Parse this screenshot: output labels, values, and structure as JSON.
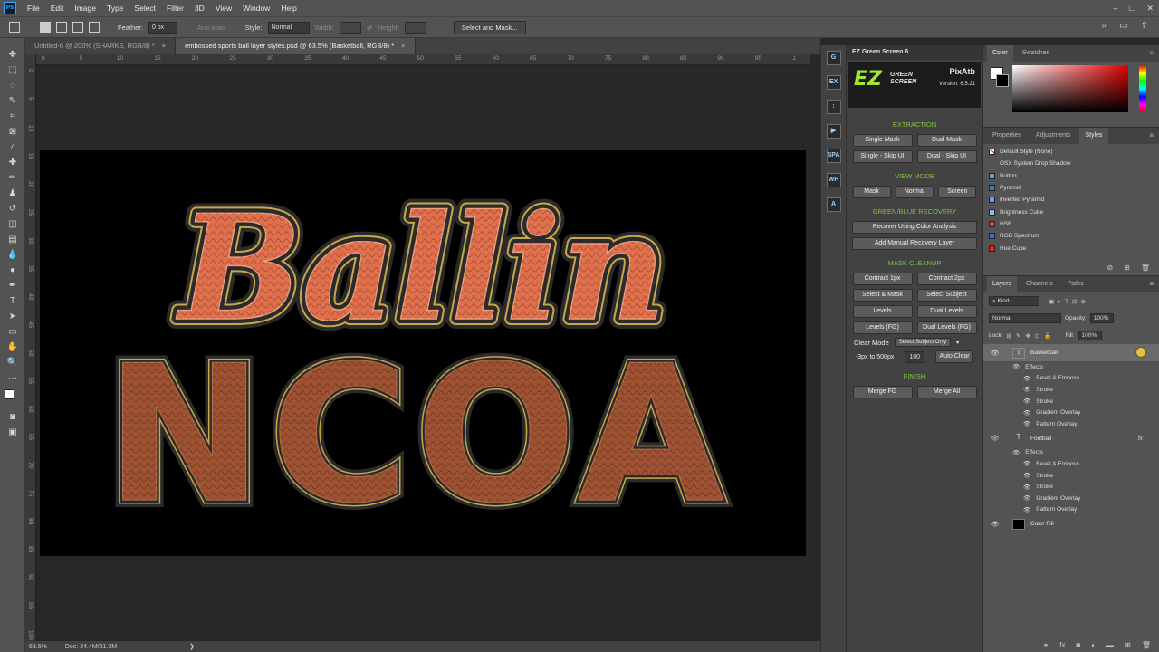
{
  "app": {
    "logo": "Ps"
  },
  "menu": [
    "File",
    "Edit",
    "Image",
    "Type",
    "Select",
    "Filter",
    "3D",
    "View",
    "Window",
    "Help"
  ],
  "window_controls": [
    "–",
    "❐",
    "✕"
  ],
  "options_bar": {
    "feather_label": "Feather:",
    "feather_value": "0 px",
    "anti_alias_label": "Anti-alias",
    "style_label": "Style:",
    "style_value": "Normal",
    "width_label": "Width:",
    "height_label": "Height:",
    "select_mask_button": "Select and Mask..."
  },
  "tabs": [
    {
      "label": "Untitled-6 @ 200% (SHARKS, RGB/8) *",
      "close": "×"
    },
    {
      "label": "embossed sports ball layer styles.psd @ 63.5% (Basketball, RGB/8) *",
      "close": "×"
    }
  ],
  "ruler": {
    "h_ticks": [
      "0",
      "5",
      "10",
      "15",
      "20",
      "25",
      "30",
      "35",
      "40",
      "45",
      "50",
      "55",
      "60",
      "65",
      "70",
      "75",
      "80",
      "85",
      "90",
      "95",
      "1"
    ],
    "v_ticks": [
      "0",
      "5",
      "10",
      "15",
      "20",
      "25",
      "30",
      "35",
      "40",
      "45",
      "50",
      "55",
      "60",
      "65",
      "70",
      "75",
      "80",
      "85",
      "90",
      "95",
      "100"
    ]
  },
  "canvas": {
    "line1": "Ballin",
    "line2": "NCOA",
    "colors": {
      "ballin_fill": "#e2704c",
      "ncoa_fill": "#9e5232",
      "stroke_gold": "#c8a64a",
      "stroke_dark": "#2a2a2a"
    }
  },
  "status": {
    "zoom": "63.5%",
    "doc": "Doc: 24.4M/31.3M",
    "arrow": "❯"
  },
  "ez_strip": [
    "G",
    "EX",
    "↕",
    "▶",
    "SPA",
    "WH",
    "A"
  ],
  "ez_panel": {
    "title": "EZ Green Screen 6",
    "logo": "EZ",
    "logo_sub1": "GREEN",
    "logo_sub2": "SCREEN",
    "brand": "PixAtb",
    "version": "Version: 6.5.21",
    "sections": {
      "extraction": "EXTRACTION",
      "view_mode": "VIEW MODE",
      "recovery": "GREEN/BLUE RECOVERY",
      "cleanup": "MASK CLEANUP",
      "finish": "FINISH"
    },
    "buttons": {
      "single_mask": "Single Mask",
      "dual_mask": "Dual Mask",
      "single_skip": "Single - Skip UI",
      "dual_skip": "Dual - Skip UI",
      "mask": "Mask",
      "normal": "Normal",
      "screen": "Screen",
      "recover_color": "Recover Using Color Analysis",
      "add_manual": "Add Manual Recovery Layer",
      "contract1": "Contract 1px",
      "contract2": "Contract 2px",
      "select_mask": "Select & Mask",
      "select_subject": "Select Subject",
      "levels": "Levels",
      "dual_levels": "Dual Levels",
      "levels_fg": "Levels (FG)",
      "dual_levels_fg": "Dual Levels (FG)",
      "auto_clear": "Auto Clear",
      "merge_fg": "Merge FG",
      "merge_all": "Merge All"
    },
    "clear_mode_label": "Clear Mode",
    "clear_mode_value": "Select Subject Only",
    "range_label": "-3px to 500px",
    "range_value": "100"
  },
  "color_panel": {
    "tabs": [
      "Color",
      "Swatches"
    ]
  },
  "styles_panel": {
    "tabs": [
      "Properties",
      "Adjustments",
      "Styles"
    ],
    "items": [
      {
        "label": "Default Style (None)",
        "swatch": "#ffffff"
      },
      {
        "label": "OSX System Drop Shadow",
        "swatch": "#535353"
      },
      {
        "label": "Button",
        "swatch": "#4aa3df"
      },
      {
        "label": "Pyramid",
        "swatch": "#3b7bd4"
      },
      {
        "label": "Inverted Pyramid",
        "swatch": "#5fa0e8"
      },
      {
        "label": "Brightness Cube",
        "swatch": "#88bbee"
      },
      {
        "label": "HSB",
        "swatch": "#d04040"
      },
      {
        "label": "RGB Spectrum",
        "swatch": "#3a6fd8"
      },
      {
        "label": "Hue Cube",
        "swatch": "#e02020"
      }
    ]
  },
  "layers_panel": {
    "tabs": [
      "Layers",
      "Channels",
      "Paths"
    ],
    "kind": "Kind",
    "blend": "Normal",
    "opacity_label": "Opacity:",
    "opacity_value": "100%",
    "lock_label": "Lock:",
    "fill_label": "Fill:",
    "fill_value": "100%",
    "effects_label": "Effects",
    "layers": [
      {
        "name": "Basketball",
        "effects": [
          "Bevel & Emboss",
          "Stroke",
          "Stroke",
          "Gradient Overlay",
          "Pattern Overlay"
        ]
      },
      {
        "name": "Football",
        "effects": [
          "Bevel & Emboss",
          "Stroke",
          "Stroke",
          "Gradient Overlay",
          "Pattern Overlay"
        ]
      },
      {
        "name": "Color Fill",
        "effects": []
      }
    ]
  }
}
